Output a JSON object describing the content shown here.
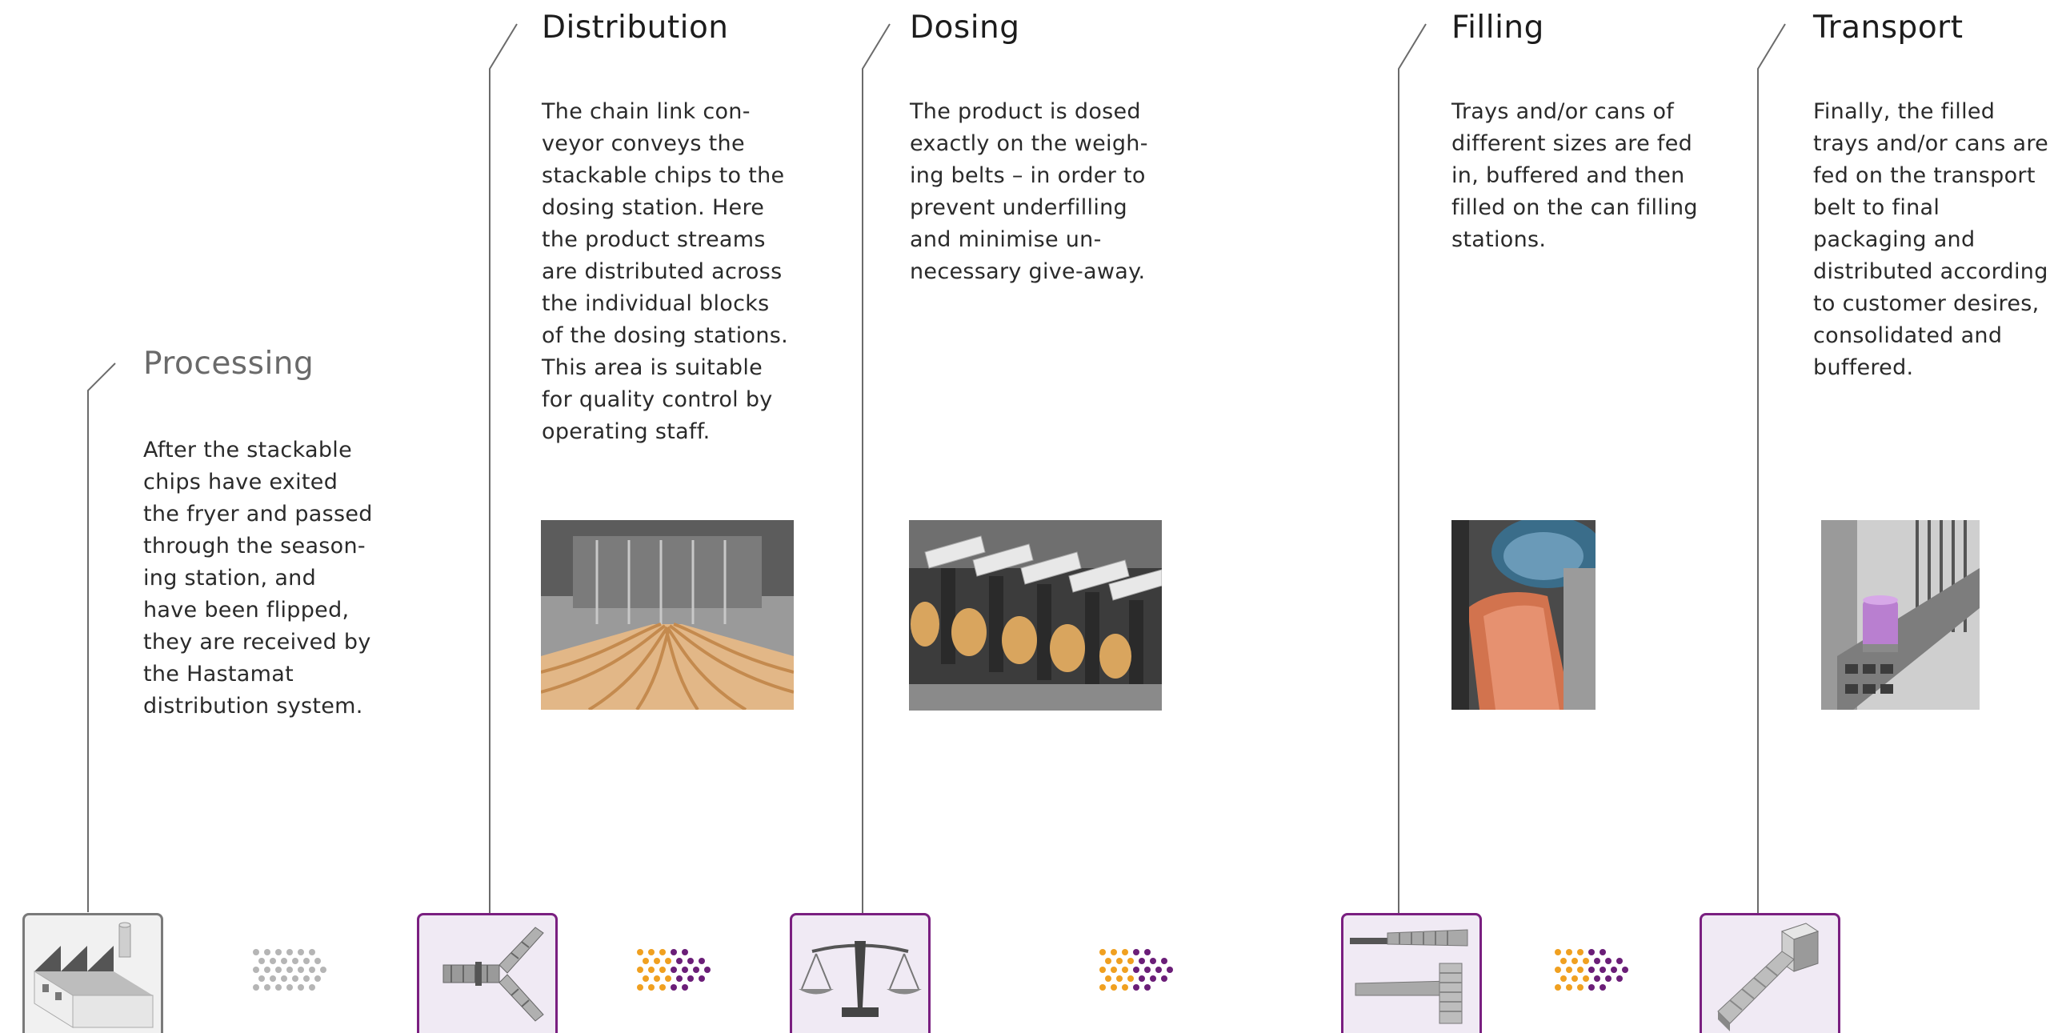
{
  "steps": [
    {
      "title": "Processing",
      "description": "After the stackable chips have exited the fryer and passed through the season­ing station, and have been flipped, they are received by the Hastamat distribu­tion system.",
      "icon": "factory-icon"
    },
    {
      "title": "Distribution",
      "description": "The chain link con­veyor conveys the stackable chips to the dosing station. Here the product streams are distributed across the individual blocks of the dosing stations. This area is suitable for quality control by operating staff.",
      "icon": "distribution-conveyor-icon",
      "photo": "distribution-photo"
    },
    {
      "title": "Dosing",
      "description": "The product is dosed exactly on the weigh­ing belts – in order to prevent underfilling and minimise un­necessary give-away.",
      "icon": "scale-icon",
      "photo": "dosing-photo"
    },
    {
      "title": "Filling",
      "description": "Trays and/or cans of different sizes are fed in, buffered and then filled on the can filling stations.",
      "icon": "filling-station-icon",
      "photo": "filling-photo"
    },
    {
      "title": "Transport",
      "description": "Finally, the filled trays and/or cans are fed on the transport belt to final packaging and distributed according to customer desires, consolidated and buffered.",
      "icon": "transport-belt-icon",
      "photo": "transport-photo"
    }
  ],
  "colors": {
    "accent_purple": "#6b1e78",
    "accent_orange": "#f0a020",
    "icon_bg": "#f0eaf4",
    "line_gray": "#6b6b6b"
  }
}
